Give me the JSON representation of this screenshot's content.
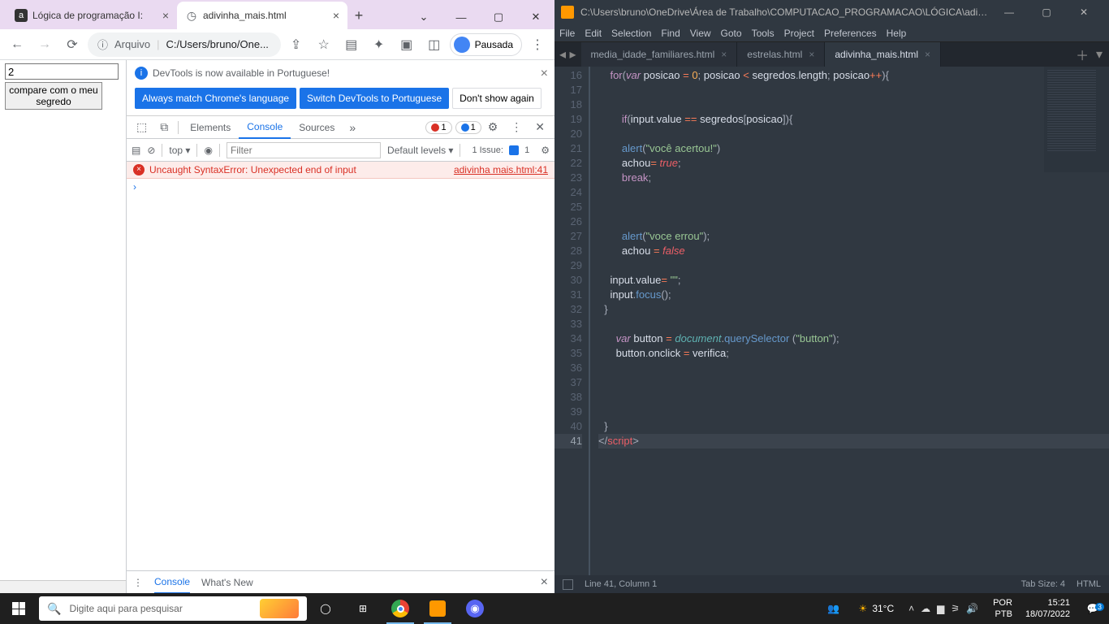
{
  "chrome": {
    "tabs": [
      {
        "title": "Lógica de programação I:",
        "favicon": "a"
      },
      {
        "title": "adivinha_mais.html",
        "favicon": "globe"
      }
    ],
    "activeTab": 1,
    "omnibox_prefix": "Arquivo",
    "omnibox_url": "C:/Users/bruno/One...",
    "profile_label": "Pausada",
    "page": {
      "input_value": "2",
      "button_label": "compare com o meu segredo"
    }
  },
  "devtools": {
    "info_text": "DevTools is now available in Portuguese!",
    "btn_always": "Always match Chrome's language",
    "btn_switch": "Switch DevTools to Portuguese",
    "btn_dont": "Don't show again",
    "tabs": {
      "elements": "Elements",
      "console": "Console",
      "sources": "Sources"
    },
    "error_count": "1",
    "msg_count": "1",
    "context_label": "top ▾",
    "filter_placeholder": "Filter",
    "levels_label": "Default levels ▾",
    "issues_label": "1 Issue:",
    "issues_count": "1",
    "error_msg": "Uncaught SyntaxError: Unexpected end of input",
    "error_src": "adivinha mais.html:41",
    "drawer": {
      "console": "Console",
      "whatsnew": "What's New"
    }
  },
  "sublime": {
    "title": "C:\\Users\\bruno\\OneDrive\\Área de Trabalho\\COMPUTACAO_PROGRAMACAO\\LÓGICA\\adivinh...",
    "menus": [
      "File",
      "Edit",
      "Selection",
      "Find",
      "View",
      "Goto",
      "Tools",
      "Project",
      "Preferences",
      "Help"
    ],
    "tabs": [
      {
        "name": "media_idade_familiares.html"
      },
      {
        "name": "estrelas.html"
      },
      {
        "name": "adivinha_mais.html"
      }
    ],
    "activeTab": 2,
    "first_line_no": 16,
    "last_line_no": 41,
    "current_line": 41,
    "status_left": "Line 41, Column 1",
    "status_tab": "Tab Size: 4",
    "status_lang": "HTML"
  },
  "taskbar": {
    "search_placeholder": "Digite aqui para pesquisar",
    "weather_temp": "31°C",
    "lang1": "POR",
    "lang2": "PTB",
    "time": "15:21",
    "date": "18/07/2022",
    "notif_count": "3"
  }
}
